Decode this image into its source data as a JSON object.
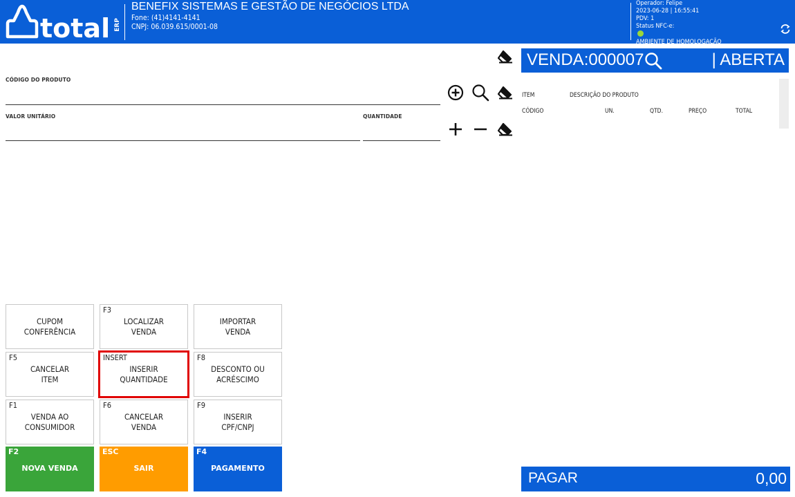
{
  "header": {
    "logo_text": "total",
    "logo_badge": "ERP",
    "company_name": "BENEFIX SISTEMAS E GESTÃO DE NEGÓCIOS LTDA",
    "phone": "Fone: (41)4141-4141",
    "cnpj": "CNPJ: 06.039.615/0001-08",
    "operator": "Operador: Felipe",
    "datetime": "2023-06-28 | 16:55:41",
    "pdv": "PDV: 1",
    "nfce_status_label": "Status NFC-e:",
    "nfce_status_color": "#9ad63a",
    "environment": "AMBIENTE DE HOMOLOGAÇÃO",
    "refresh_icon": "refresh-icon"
  },
  "form": {
    "product_code_label": "CÓDIGO DO PRODUTO",
    "product_code_value": "",
    "unit_value_label": "VALOR UNITÁRIO",
    "unit_value_value": "",
    "quantity_label": "QUANTIDADE",
    "quantity_value": ""
  },
  "sale": {
    "title": "VENDA:000007",
    "status": "| ABERTA",
    "columns_row1": [
      "ITEM",
      "DESCRIÇÃO DO PRODUTO"
    ],
    "columns_row2": [
      "CÓDIGO",
      "UN.",
      "QTD.",
      "PREÇO",
      "TOTAL"
    ],
    "items": []
  },
  "keys": [
    {
      "key": "",
      "label": "CUPOM\nCONFERÊNCIA"
    },
    {
      "key": "F3",
      "label": "LOCALIZAR\nVENDA"
    },
    {
      "key": "",
      "label": "IMPORTAR\nVENDA"
    },
    {
      "key": "F5",
      "label": "CANCELAR\nITEM"
    },
    {
      "key": "INSERT",
      "label": "INSERIR\nQUANTIDADE"
    },
    {
      "key": "F8",
      "label": "DESCONTO OU\nACRÉSCIMO"
    },
    {
      "key": "F1",
      "label": "VENDA AO\nCONSUMIDOR"
    },
    {
      "key": "F6",
      "label": "CANCELAR\nVENDA"
    },
    {
      "key": "F9",
      "label": "INSERIR\nCPF/CNPJ"
    },
    {
      "key": "F2",
      "label": "NOVA VENDA",
      "color": "#3aa53a"
    },
    {
      "key": "ESC",
      "label": "SAIR",
      "color": "#ff9c00"
    },
    {
      "key": "F4",
      "label": "PAGAMENTO",
      "color": "#0a5fd7"
    }
  ],
  "payment": {
    "label": "PAGAR",
    "value": "0,00"
  },
  "colors": {
    "brand_blue": "#0a5fd7",
    "highlight_red": "#e00000"
  }
}
